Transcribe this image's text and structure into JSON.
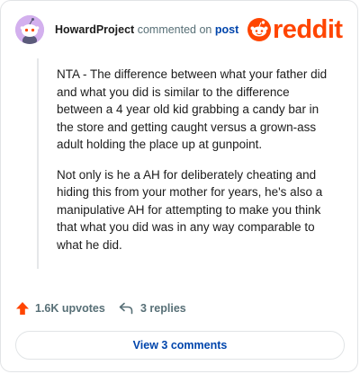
{
  "comment": {
    "author": "HowardProject",
    "action_text": "commented on",
    "target_link": "post",
    "avatar_color": "#c9a0e6",
    "paragraphs": [
      "NTA - The difference between what your father did and what you did is similar to the difference between a 4 year old kid grabbing a candy bar in the store and getting caught versus a grown-ass adult holding the place up at gunpoint.",
      "Not only is he a AH for deliberately cheating and hiding this from your mother for years, he's also a manipulative AH for attempting to make you think that what you did was in any way comparable to what he did."
    ]
  },
  "brand": {
    "logo_text": "reddit",
    "accent_color": "#ff4500",
    "logo_icon": "reddit-snoo-icon"
  },
  "actions": {
    "upvotes_label": "1.6K upvotes",
    "upvote_icon": "upvote-arrow-icon",
    "replies_label": "3 replies",
    "reply_icon": "reply-arrow-icon"
  },
  "footer": {
    "view_comments_label": "View 3 comments"
  }
}
